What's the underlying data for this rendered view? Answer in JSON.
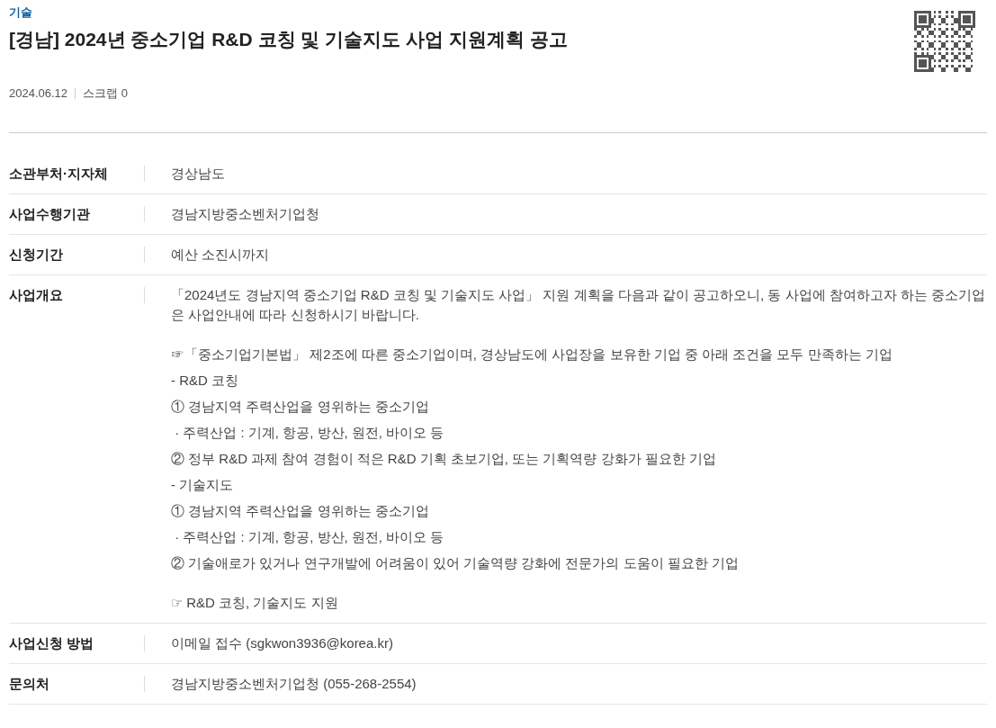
{
  "category": "기술",
  "title": "[경남] 2024년 중소기업 R&D 코칭 및 기술지도 사업 지원계획 공고",
  "meta": {
    "date": "2024.06.12",
    "scrap": "스크랩 0"
  },
  "rows": [
    {
      "label": "소관부처·지자체",
      "value": "경상남도"
    },
    {
      "label": "사업수행기관",
      "value": "경남지방중소벤처기업청"
    },
    {
      "label": "신청기간",
      "value": "예산 소진시까지"
    },
    {
      "label": "사업개요",
      "paragraphs": [
        {
          "lines": [
            "「2024년도 경남지역 중소기업 R&D 코칭 및 기술지도 사업」 지원 계획을 다음과 같이 공고하오니, 동 사업에 참여하고자 하는 중소기업은 사업안내에 따라 신청하시기 바랍니다."
          ]
        },
        {
          "lines": [
            "☞「중소기업기본법」 제2조에 따른 중소기업이며, 경상남도에 사업장을 보유한 기업 중 아래 조건을 모두 만족하는 기업",
            "- R&D 코칭",
            "① 경남지역 주력산업을 영위하는 중소기업",
            " · 주력산업 : 기계, 항공, 방산, 원전, 바이오 등",
            "② 정부 R&D 과제 참여 경험이 적은 R&D 기획 초보기업, 또는 기획역량 강화가 필요한 기업",
            "- 기술지도",
            "① 경남지역 주력산업을 영위하는 중소기업",
            " · 주력산업 : 기계, 항공, 방산, 원전, 바이오 등",
            "② 기술애로가 있거나 연구개발에 어려움이 있어 기술역량 강화에 전문가의 도움이 필요한 기업"
          ]
        },
        {
          "lines": [
            "☞ R&D 코칭, 기술지도 지원"
          ]
        }
      ]
    },
    {
      "label": "사업신청 방법",
      "value": "이메일 접수 (sgkwon3936@korea.kr)"
    },
    {
      "label": "문의처",
      "value": "경남지방중소벤처기업청 (055-268-2554)"
    }
  ]
}
